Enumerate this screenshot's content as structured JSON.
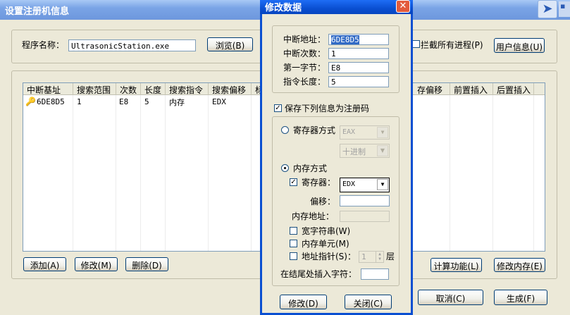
{
  "main_window": {
    "title": "设置注册机信息",
    "program_label": "程序名称：",
    "program_value": "UltrasonicStation.exe",
    "browse_button": "浏览(B)",
    "intercept_all_label": "拦截所有进程(P)",
    "user_info_button": "用户信息(U)",
    "list_columns": [
      "中断基址",
      "搜索范围",
      "次数",
      "长度",
      "搜索指令",
      "搜索偏移",
      "标",
      "存偏移",
      "前置插入",
      "后置插入"
    ],
    "list_rows": [
      {
        "base": "6DE8D5",
        "range": "1",
        "count": "E8",
        "length": "5",
        "instr": "内存",
        "offset": "EDX"
      }
    ],
    "add_button": "添加(A)",
    "modify_button": "修改(M)",
    "delete_button": "删除(D)",
    "calc_button": "计算功能(L)",
    "mod_mem_button": "修改内存(E)",
    "cancel_button": "取消(C)",
    "generate_button": "生成(F)"
  },
  "dialog": {
    "title": "修改数据",
    "close_glyph": "✕",
    "interrupt_addr_label": "中断地址：",
    "interrupt_addr_value": "6DE8D5",
    "interrupt_count_label": "中断次数：",
    "interrupt_count_value": "1",
    "first_byte_label": "第一字节：",
    "first_byte_value": "E8",
    "instr_len_label": "指令长度：",
    "instr_len_value": "5",
    "save_label": "保存下列信息为注册码",
    "register_mode_label": "寄存器方式",
    "register_combo_value": "EAX",
    "radix_combo_value": "十进制",
    "memory_mode_label": "内存方式",
    "register_label": "寄存器：",
    "register_value": "EDX",
    "offset_label": "偏移：",
    "mem_addr_label": "内存地址：",
    "wide_string_label": "宽字符串(W)",
    "memory_unit_label": "内存单元(M)",
    "addr_pointer_label": "地址指针(S)：",
    "pointer_level_value": "1",
    "pointer_level_suffix": "层",
    "insert_tail_label": "在结尾处插入字符：",
    "modify_button": "修改(D)",
    "close_button": "关闭(C)"
  }
}
